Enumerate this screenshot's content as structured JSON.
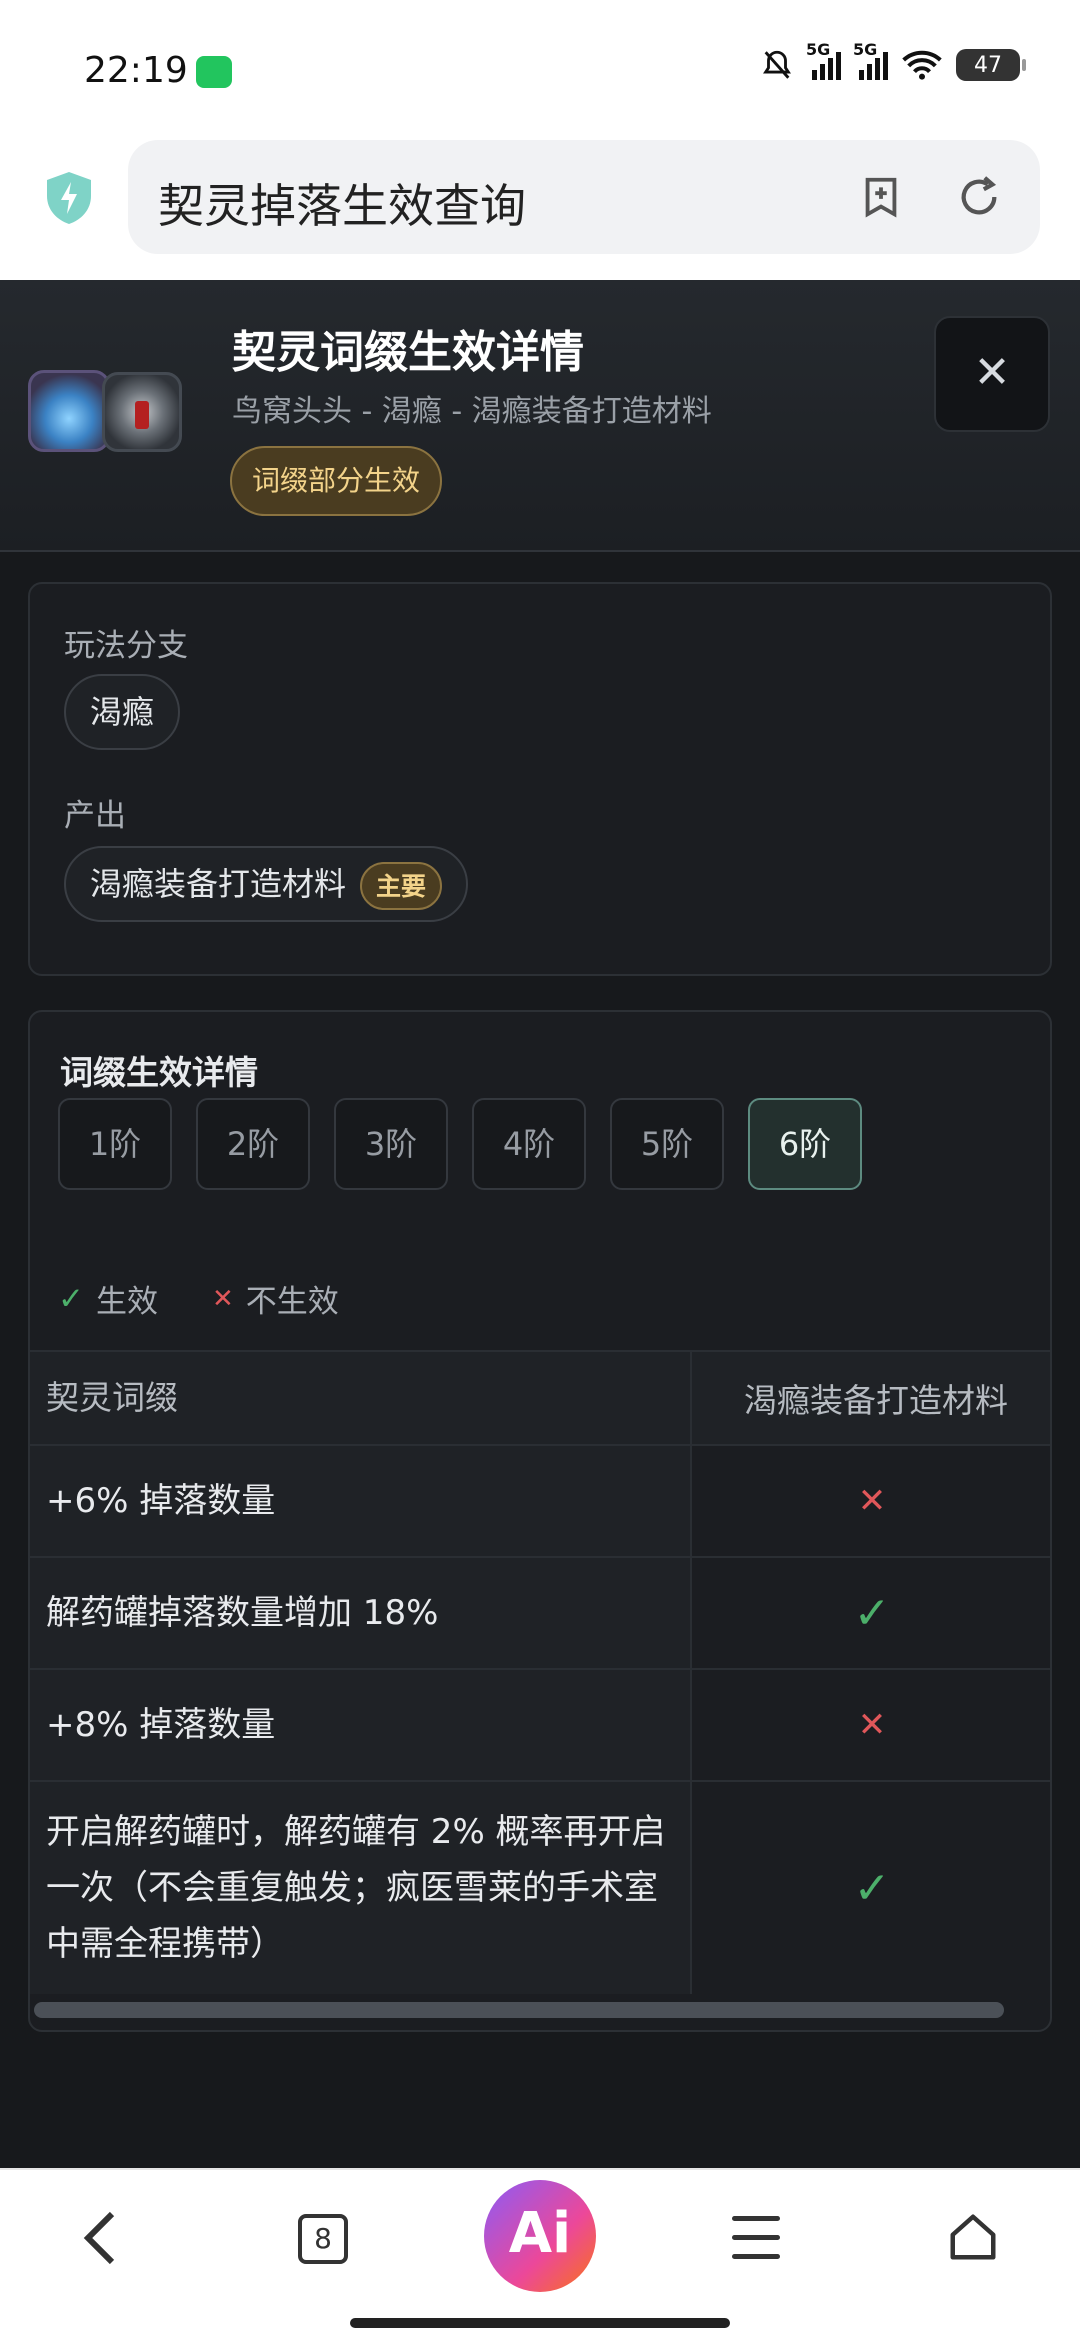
{
  "status_bar": {
    "time": "22:19",
    "network_1": "5G",
    "network_2": "5G",
    "battery": "47"
  },
  "search": {
    "query": "契灵掉落生效查询"
  },
  "detail": {
    "title": "契灵词缀生效详情",
    "subtitle": "鸟窝头头 - 渴瘾 - 渴瘾装备打造材料",
    "badge": "词缀部分生效",
    "close_label": "✕"
  },
  "branch": {
    "label": "玩法分支",
    "value": "渴瘾"
  },
  "output": {
    "label": "产出",
    "value": "渴瘾装备打造材料",
    "tag": "主要"
  },
  "affix_section": {
    "title": "词缀生效详情",
    "tiers": [
      "1阶",
      "2阶",
      "3阶",
      "4阶",
      "5阶",
      "6阶"
    ],
    "selected_tier": "6阶",
    "legend": {
      "effective": "生效",
      "not_effective": "不生效"
    },
    "table": {
      "headers": [
        "契灵词缀",
        "渴瘾装备打造材料"
      ],
      "rows": [
        {
          "affix": "+6% 掉落数量",
          "status": "✕"
        },
        {
          "affix": "解药罐掉落数量增加 18%",
          "status": "✓"
        },
        {
          "affix": "+8% 掉落数量",
          "status": "✕"
        },
        {
          "affix": "开启解药罐时，解药罐有 2% 概率再开启一次（不会重复触发；疯医雪莱的手术室中需全程携带）",
          "status": "✓"
        }
      ]
    }
  },
  "bottom_nav": {
    "tabs_count": "8",
    "ai_label": "Ai"
  },
  "colors": {
    "accent_gold": "#f3d38a",
    "ok_green": "#4caf6a",
    "bad_red": "#e0575a",
    "dark_bg": "#17191c"
  }
}
